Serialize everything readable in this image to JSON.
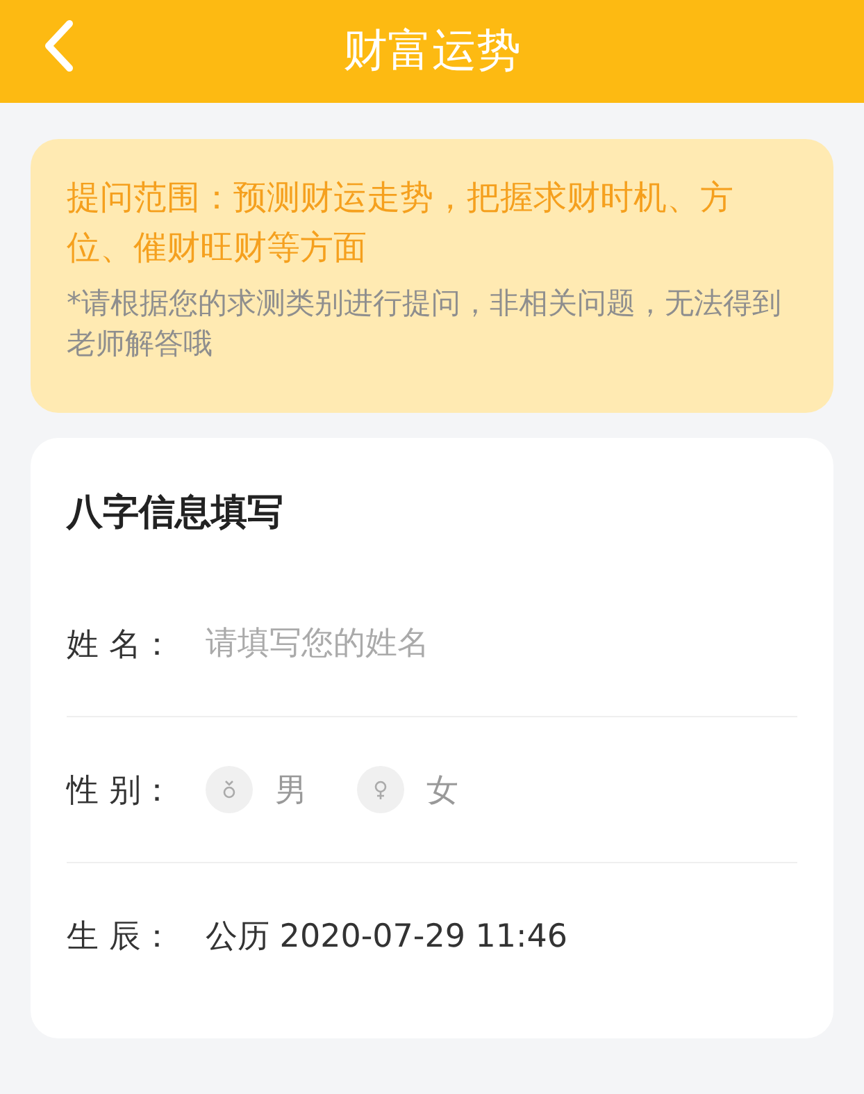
{
  "header": {
    "title": "财富运势"
  },
  "notice": {
    "scope": "提问范围：预测财运走势，把握求财时机、方位、催财旺财等方面",
    "hint": "*请根据您的求测类别进行提问，非相关问题，无法得到老师解答哦"
  },
  "form": {
    "title": "八字信息填写",
    "rows": [
      {
        "kind": "input",
        "label": "姓 名：",
        "placeholder": "请填写您的姓名"
      },
      {
        "kind": "gender",
        "label": "性 别：",
        "options": [
          {
            "label": "男",
            "kind": "male",
            "selected": false
          },
          {
            "label": "女",
            "kind": "female",
            "selected": false
          }
        ]
      },
      {
        "kind": "text",
        "label": "生 辰：",
        "value": "公历 2020-07-29 11:46"
      }
    ]
  }
}
